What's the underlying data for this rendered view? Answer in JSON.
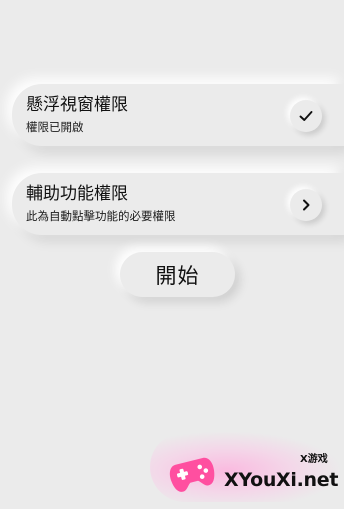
{
  "permissions": [
    {
      "title": "懸浮視窗權限",
      "subtitle": "權限已開啟",
      "action_icon": "checkmark-icon"
    },
    {
      "title": "輔助功能權限",
      "subtitle": "此為自動點擊功能的必要權限",
      "action_icon": "chevron-right-icon"
    }
  ],
  "start_button": {
    "label": "開始"
  },
  "watermark": {
    "top_text": "X游戏",
    "main_text": "XYouXi.net"
  },
  "colors": {
    "background": "#ebebeb",
    "text": "#111111",
    "watermark_logo": "#ff4fa0"
  }
}
